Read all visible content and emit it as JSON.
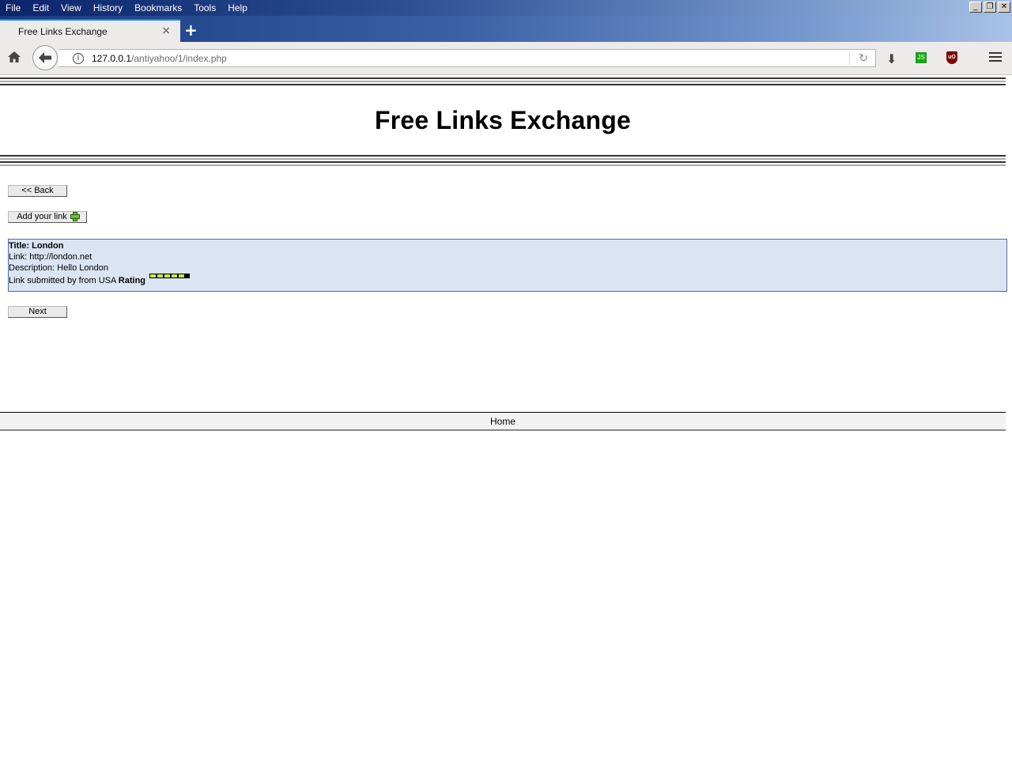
{
  "browser": {
    "menu": [
      "File",
      "Edit",
      "View",
      "History",
      "Bookmarks",
      "Tools",
      "Help"
    ],
    "tab_title": "Free Links Exchange",
    "url_host": "127.0.0.1",
    "url_path": "/antiyahoo/1/index.php",
    "window_controls": [
      "minimize-icon",
      "restore-icon",
      "close-icon"
    ],
    "toolbar_icons": [
      "home-icon",
      "back-arrow-icon",
      "info-icon",
      "reload-icon",
      "download-icon",
      "js-extension-icon",
      "ublock-icon",
      "hamburger-menu-icon"
    ],
    "js_icon_label": "JS",
    "ublock_label": "uO"
  },
  "page": {
    "title": "Free Links Exchange",
    "back_label": "<< Back",
    "add_link_label": "Add your link",
    "next_label": "Next",
    "footer_home": "Home",
    "accent_colors": {
      "box_bg": "#dbe4f3",
      "box_border": "#4a6fa5",
      "rating": "#c8e65a"
    }
  },
  "link": {
    "title": "Title: London",
    "link": "Link: http://london.net",
    "description": "Description: Hello London",
    "submitted": "Link submitted by from USA",
    "rating_label": "Rating",
    "rating_value": 5,
    "rating_max": 5
  }
}
